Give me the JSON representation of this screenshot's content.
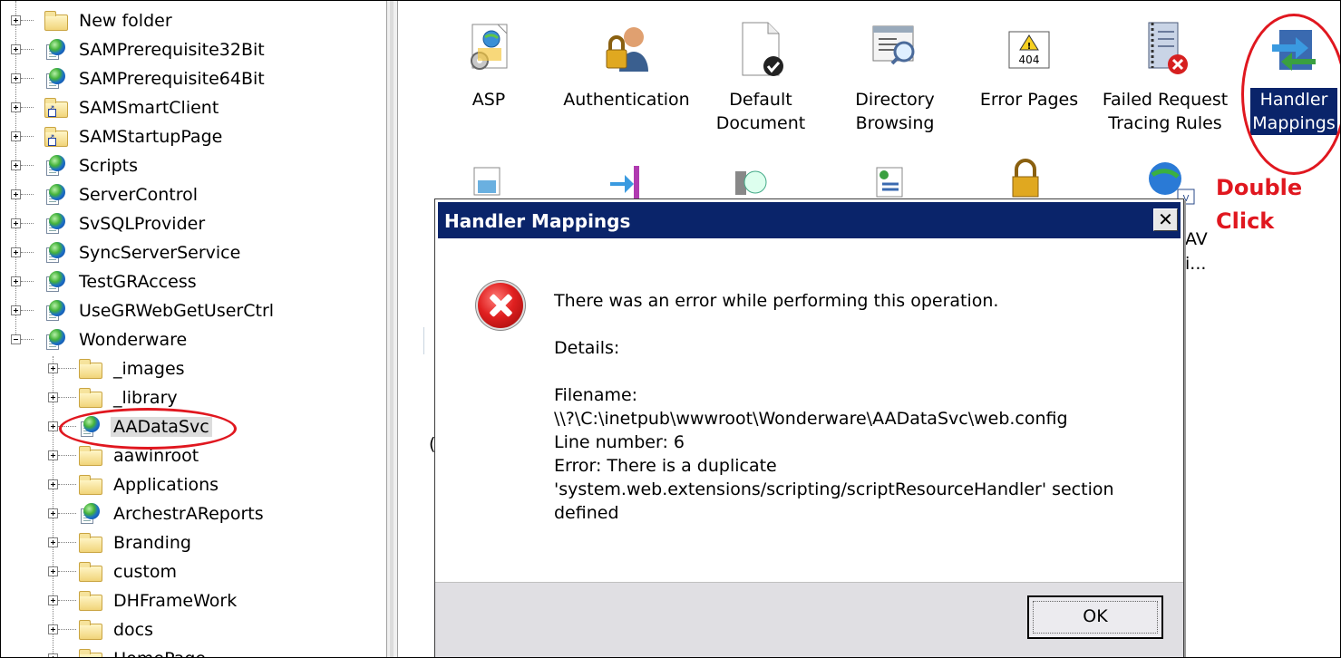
{
  "tree": {
    "items": [
      {
        "label": "New folder",
        "icon": "folder-icon"
      },
      {
        "label": "SAMPrerequisite32Bit",
        "icon": "web-app-icon"
      },
      {
        "label": "SAMPrerequisite64Bit",
        "icon": "web-app-icon"
      },
      {
        "label": "SAMSmartClient",
        "icon": "virtual-dir-icon"
      },
      {
        "label": "SAMStartupPage",
        "icon": "virtual-dir-icon"
      },
      {
        "label": "Scripts",
        "icon": "web-app-icon"
      },
      {
        "label": "ServerControl",
        "icon": "web-app-icon"
      },
      {
        "label": "SvSQLProvider",
        "icon": "web-app-icon"
      },
      {
        "label": "SyncServerService",
        "icon": "web-app-icon"
      },
      {
        "label": "TestGRAccess",
        "icon": "web-app-icon"
      },
      {
        "label": "UseGRWebGetUserCtrl",
        "icon": "web-app-icon"
      },
      {
        "label": "Wonderware",
        "icon": "web-app-icon"
      }
    ],
    "children": [
      {
        "label": "_images",
        "icon": "folder-icon"
      },
      {
        "label": "_library",
        "icon": "folder-icon"
      },
      {
        "label": "AADataSvc",
        "icon": "web-app-icon"
      },
      {
        "label": "aawinroot",
        "icon": "folder-icon"
      },
      {
        "label": "Applications",
        "icon": "folder-icon"
      },
      {
        "label": "ArchestrAReports",
        "icon": "web-app-icon"
      },
      {
        "label": "Branding",
        "icon": "folder-icon"
      },
      {
        "label": "custom",
        "icon": "folder-icon"
      },
      {
        "label": "DHFrameWork",
        "icon": "folder-icon"
      },
      {
        "label": "docs",
        "icon": "folder-icon"
      },
      {
        "label": "HomePage",
        "icon": "folder-icon"
      }
    ]
  },
  "features": [
    {
      "label": "ASP",
      "icon": "asp-icon"
    },
    {
      "label": "Authentication",
      "icon": "authentication-icon"
    },
    {
      "label": "Default\nDocument",
      "icon": "default-document-icon"
    },
    {
      "label": "Directory\nBrowsing",
      "icon": "directory-browsing-icon"
    },
    {
      "label": "Error Pages",
      "icon": "error-pages-icon",
      "badge": "404"
    },
    {
      "label": "Failed Request\nTracing Rules",
      "icon": "failed-request-icon"
    },
    {
      "label": "Handler\nMappings",
      "icon": "handler-mappings-icon"
    }
  ],
  "partial_labels": {
    "webdav_a": "AV",
    "webdav_b": "i..."
  },
  "annotation": {
    "line1": "Double",
    "line2": "Click",
    "color": "#e0171f"
  },
  "dialog": {
    "title": "Handler Mappings",
    "close_glyph": "✕",
    "message": "There was an error while performing this operation.",
    "details_label": "Details:",
    "filename_label": "Filename:",
    "filename_value": "\\\\?\\C:\\inetpub\\wwwroot\\Wonderware\\AADataSvc\\web.config",
    "line_number": "Line number: 6",
    "error_line1": "Error: There is a duplicate",
    "error_line2": "'system.web.extensions/scripting/scriptResourceHandler' section",
    "error_line3": "defined",
    "ok_label": "OK"
  },
  "colors": {
    "title_bar": "#0a246a",
    "selection": "#0a246a",
    "error_red": "#e0171f"
  }
}
